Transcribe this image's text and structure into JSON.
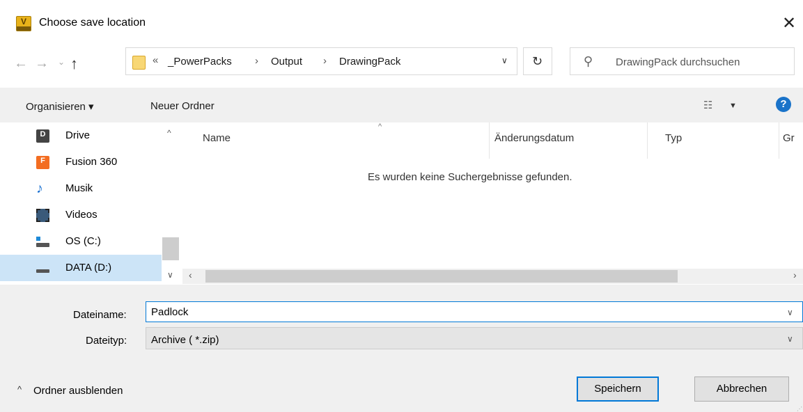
{
  "window": {
    "title": "Choose save location",
    "app_icon_letter": "V"
  },
  "address_bar": {
    "more": "«",
    "crumbs": [
      "_PowerPacks",
      "Output",
      "DrawingPack"
    ],
    "separator": "›"
  },
  "search": {
    "placeholder": "DrawingPack durchsuchen"
  },
  "toolbar": {
    "organize_label": "Organisieren ▾",
    "new_folder_label": "Neuer Ordner",
    "help_label": "?"
  },
  "nav_pane": {
    "items": [
      {
        "label": "Drive",
        "icon": "drive-app-icon"
      },
      {
        "label": "Fusion 360",
        "icon": "fusion-360-icon"
      },
      {
        "label": "Musik",
        "icon": "music-icon"
      },
      {
        "label": "Videos",
        "icon": "videos-icon"
      },
      {
        "label": "OS (C:)",
        "icon": "os-drive-icon"
      },
      {
        "label": "DATA (D:)",
        "icon": "data-drive-icon",
        "selected": true
      }
    ]
  },
  "file_list": {
    "columns": [
      "Name",
      "Änderungsdatum",
      "Typ",
      "Gr"
    ],
    "empty_message": "Es wurden keine Suchergebnisse gefunden."
  },
  "form": {
    "filename_label": "Dateiname:",
    "filename_value": "Padlock",
    "filetype_label": "Dateityp:",
    "filetype_value": "Archive ( *.zip)"
  },
  "footer": {
    "hide_folders_label": "Ordner ausblenden",
    "save_label": "Speichern",
    "cancel_label": "Abbrechen"
  },
  "colors": {
    "accent": "#0078d7",
    "selection": "#cce4f7",
    "help": "#1a73c9"
  }
}
